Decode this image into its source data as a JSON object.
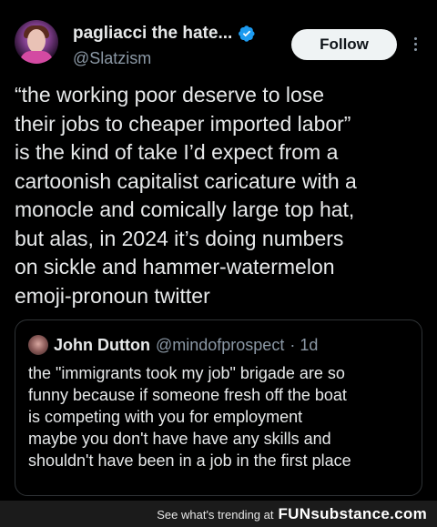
{
  "tweet": {
    "author": {
      "display_name": "pagliacci the hate...",
      "handle": "@Slatzism",
      "verified": true,
      "avatar_icon": "user-avatar"
    },
    "follow_label": "Follow",
    "more_icon": "more-options-icon",
    "text": "“the working poor deserve to lose\ntheir jobs to cheaper imported labor”\nis the kind of take I’d expect from a\ncartoonish capitalist caricature with a\nmonocle and comically large top hat,\nbut alas, in 2024 it’s doing numbers\non sickle and hammer-watermelon\nemoji-pronoun twitter"
  },
  "quote": {
    "author_name": "John Dutton",
    "handle": "@mindofprospect",
    "time": "· 1d",
    "text": "the \"immigrants took my job\"  brigade are so\nfunny because if someone fresh off the boat\nis competing with you for employment\nmaybe you don't have have any skills and\nshouldn't have been in a job in the first place"
  },
  "footer": {
    "text": "See what's trending at",
    "brand_fun": "FUN",
    "brand_sub": "substance.com"
  },
  "colors": {
    "background": "#000000",
    "text": "#e7e9ea",
    "muted": "#8b98a5",
    "verified": "#1d9bf0",
    "border": "#2f3336"
  }
}
